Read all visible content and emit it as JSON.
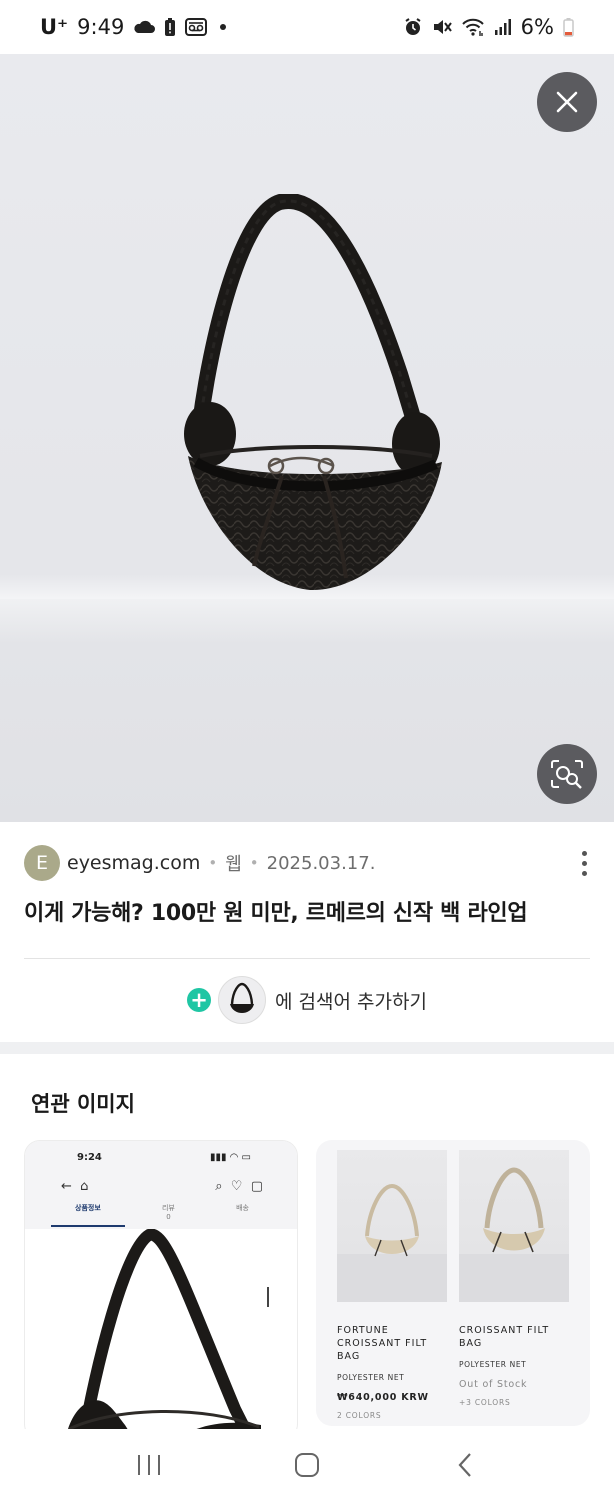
{
  "status_bar": {
    "carrier": "U⁺",
    "time": "9:49",
    "battery": "6%"
  },
  "source": {
    "avatar_letter": "E",
    "domain": "eyesmag.com",
    "type": "웹",
    "date": "2025.03.17.",
    "title": "이게 가능해? 100만 원 미만, 르메르의 신작 백 라인업"
  },
  "add_query": {
    "label": "에 검색어 추가하기"
  },
  "related": {
    "title": "연관 이미지",
    "card_a": {
      "time": "9:24",
      "tabs": [
        "상품정보",
        "리뷰",
        "배송"
      ],
      "review_count": "0"
    },
    "products": [
      {
        "name": "FORTUNE CROISSANT FILT BAG",
        "material": "POLYESTER NET",
        "price": "₩640,000 KRW",
        "colors": "2 COLORS"
      },
      {
        "name": "CROISSANT FILT BAG",
        "material": "POLYESTER NET",
        "stock": "Out of Stock",
        "colors": "+3 COLORS"
      }
    ]
  },
  "icons": {
    "close": "close-icon",
    "lens": "image-search-icon",
    "more": "more-vert-icon",
    "plus": "plus-icon",
    "nav_recents": "recents-icon",
    "nav_home": "home-icon",
    "nav_back": "back-icon"
  }
}
